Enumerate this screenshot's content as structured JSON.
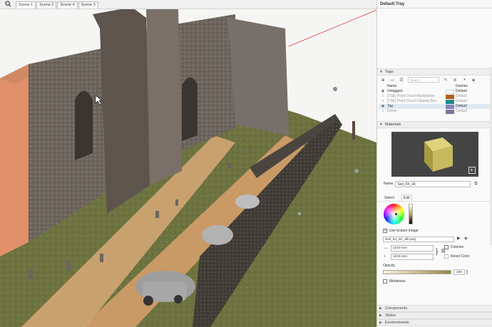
{
  "viewport": {
    "scene_tabs": [
      {
        "label": "Scene 1",
        "active": true
      },
      {
        "label": "Scene 2",
        "active": false
      },
      {
        "label": "Scene 4",
        "active": false
      },
      {
        "label": "Scene 3",
        "active": false
      }
    ],
    "icons": {
      "search": "search-icon",
      "cursor": "cursor-icon"
    }
  },
  "tray": {
    "title": "Default Tray",
    "tags": {
      "header": "Tags",
      "search_placeholder": "Search",
      "columns": {
        "name": "Name",
        "dashes": "Dashes"
      },
      "rows": [
        {
          "name": "Untagged",
          "dashes": "Default",
          "color": "#ffffff",
          "visible": true,
          "muted": false,
          "selected": false
        },
        {
          "name": "[TSE] Point Cloud Manipulator",
          "dashes": "Default",
          "color": "#b05e1e",
          "visible": false,
          "muted": true,
          "selected": false
        },
        {
          "name": "[TSE] Point Cloud Clipping Box",
          "dashes": "Default",
          "color": "#1e8a8a",
          "visible": false,
          "muted": true,
          "selected": false
        },
        {
          "name": "Tag",
          "dashes": "Default",
          "color": "#8a84b8",
          "visible": true,
          "muted": false,
          "selected": true
        },
        {
          "name": "Dome",
          "dashes": "Default",
          "color": "#7a76a0",
          "visible": false,
          "muted": true,
          "selected": false
        }
      ]
    },
    "materials": {
      "header": "Materials",
      "name_label": "Name",
      "name_value": "Soil_04_1K",
      "tabs": [
        {
          "label": "Select",
          "active": false
        },
        {
          "label": "Edit",
          "active": true
        }
      ],
      "use_texture_label": "Use texture image",
      "use_texture_checked": true,
      "texture_file": "Soil_04_1K_alb.png",
      "width_value": "1219 mm",
      "height_value": "1219 mm",
      "colorize_label": "Colorize",
      "reset_color_label": "Reset Color",
      "opacity_label": "Opacity",
      "opacity_value": "100",
      "metalness_label": "Metalness"
    },
    "collapsed_panels": [
      {
        "label": "Components"
      },
      {
        "label": "Styles"
      },
      {
        "label": "Environments"
      }
    ],
    "colors": {
      "texture": "#c7b95f",
      "accent_red": "#d33"
    }
  }
}
